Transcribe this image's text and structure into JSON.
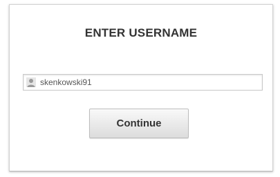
{
  "login": {
    "title": "ENTER USERNAME",
    "username": {
      "value": "skenkowski91",
      "icon": "user-icon"
    },
    "continue_label": "Continue"
  }
}
